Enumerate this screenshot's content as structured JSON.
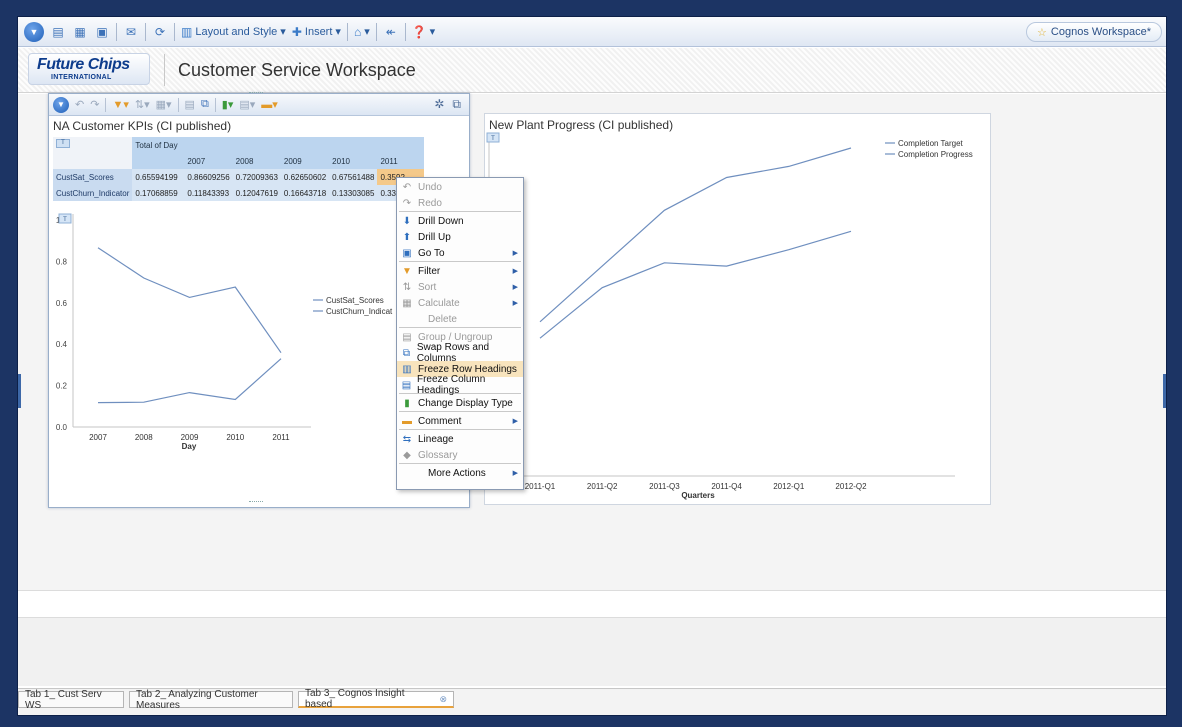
{
  "toolbar": {
    "layout_style": "Layout and Style",
    "insert": "Insert",
    "workspace": "Cognos Workspace*"
  },
  "header": {
    "logo_main": "Future Chips",
    "logo_sub": "INTERNATIONAL",
    "title": "Customer Service Workspace"
  },
  "kpi_widget": {
    "title": "NA Customer KPIs (CI published)",
    "table": {
      "top_header": "Total of Day",
      "years": [
        "2007",
        "2008",
        "2009",
        "2010",
        "2011"
      ],
      "rows": [
        {
          "label": "CustSat_Scores",
          "values": [
            "0.65594199",
            "0.86609256",
            "0.72009363",
            "0.62650602",
            "0.67561488",
            "0.3592"
          ]
        },
        {
          "label": "CustChurn_Indicator",
          "values": [
            "0.17068859",
            "0.11843393",
            "0.12047619",
            "0.16643718",
            "0.13303085",
            "0.330"
          ]
        }
      ]
    }
  },
  "plant_widget": {
    "title": "New Plant Progress (CI published)"
  },
  "chart_data": [
    {
      "type": "line",
      "categories": [
        "2007",
        "2008",
        "2009",
        "2010",
        "2011"
      ],
      "series": [
        {
          "name": "CustSat_Scores",
          "values": [
            0.866,
            0.72,
            0.626,
            0.676,
            0.359
          ]
        },
        {
          "name": "CustChurn_Indicat",
          "values": [
            0.118,
            0.12,
            0.166,
            0.133,
            0.33
          ]
        }
      ],
      "xlabel": "Day",
      "ylim": [
        0,
        1
      ],
      "yticks": [
        "0.0",
        "0.2",
        "0.4",
        "0.6",
        "0.8",
        "1.0"
      ],
      "legend": "top-right",
      "color": "#6f8fbf"
    },
    {
      "type": "line",
      "categories": [
        "2011-Q1",
        "2011-Q2",
        "2011-Q3",
        "2011-Q4",
        "2012-Q1",
        "2012-Q2"
      ],
      "series": [
        {
          "name": "Completion Target",
          "values": [
            2.35,
            3.2,
            4.05,
            4.55,
            4.72,
            5.0
          ]
        },
        {
          "name": "Completion Progress",
          "values": [
            2.1,
            2.87,
            3.25,
            3.2,
            3.45,
            3.73
          ]
        }
      ],
      "xlabel": "Quarters",
      "ylim": [
        0,
        5
      ],
      "yticks": [
        "5"
      ],
      "legend": "top-right",
      "color": "#6f8fbf"
    }
  ],
  "context_menu": {
    "items": [
      {
        "label": "Undo",
        "icon": "undo-icon",
        "disabled": true
      },
      {
        "label": "Redo",
        "icon": "redo-icon",
        "disabled": true
      },
      {
        "label": "Drill Down",
        "icon": "drill-down-icon"
      },
      {
        "label": "Drill Up",
        "icon": "drill-up-icon"
      },
      {
        "label": "Go To",
        "icon": "go-to-icon",
        "submenu": true
      },
      {
        "label": "Filter",
        "icon": "filter-icon",
        "submenu": true
      },
      {
        "label": "Sort",
        "icon": "sort-icon",
        "disabled": true,
        "submenu": true
      },
      {
        "label": "Calculate",
        "icon": "calculate-icon",
        "disabled": true,
        "submenu": true
      },
      {
        "label": "Delete",
        "disabled": true
      },
      {
        "label": "Group / Ungroup",
        "icon": "group-icon",
        "disabled": true
      },
      {
        "label": "Swap Rows and Columns",
        "icon": "swap-icon"
      },
      {
        "label": "Freeze Row Headings",
        "icon": "freeze-row-icon",
        "highlighted": true
      },
      {
        "label": "Freeze Column Headings",
        "icon": "freeze-column-icon"
      },
      {
        "label": "Change Display Type",
        "icon": "chart-type-icon"
      },
      {
        "label": "Comment",
        "icon": "comment-icon",
        "submenu": true
      },
      {
        "label": "Lineage",
        "icon": "lineage-icon"
      },
      {
        "label": "Glossary",
        "icon": "glossary-icon",
        "disabled": true
      },
      {
        "label": "More Actions",
        "submenu": true
      }
    ]
  },
  "tabs": [
    {
      "label": "Tab 1_ Cust Serv WS"
    },
    {
      "label": "Tab 2_ Analyzing Customer Measures"
    },
    {
      "label": "Tab 3_ Cognos Insight based",
      "active": true
    }
  ]
}
